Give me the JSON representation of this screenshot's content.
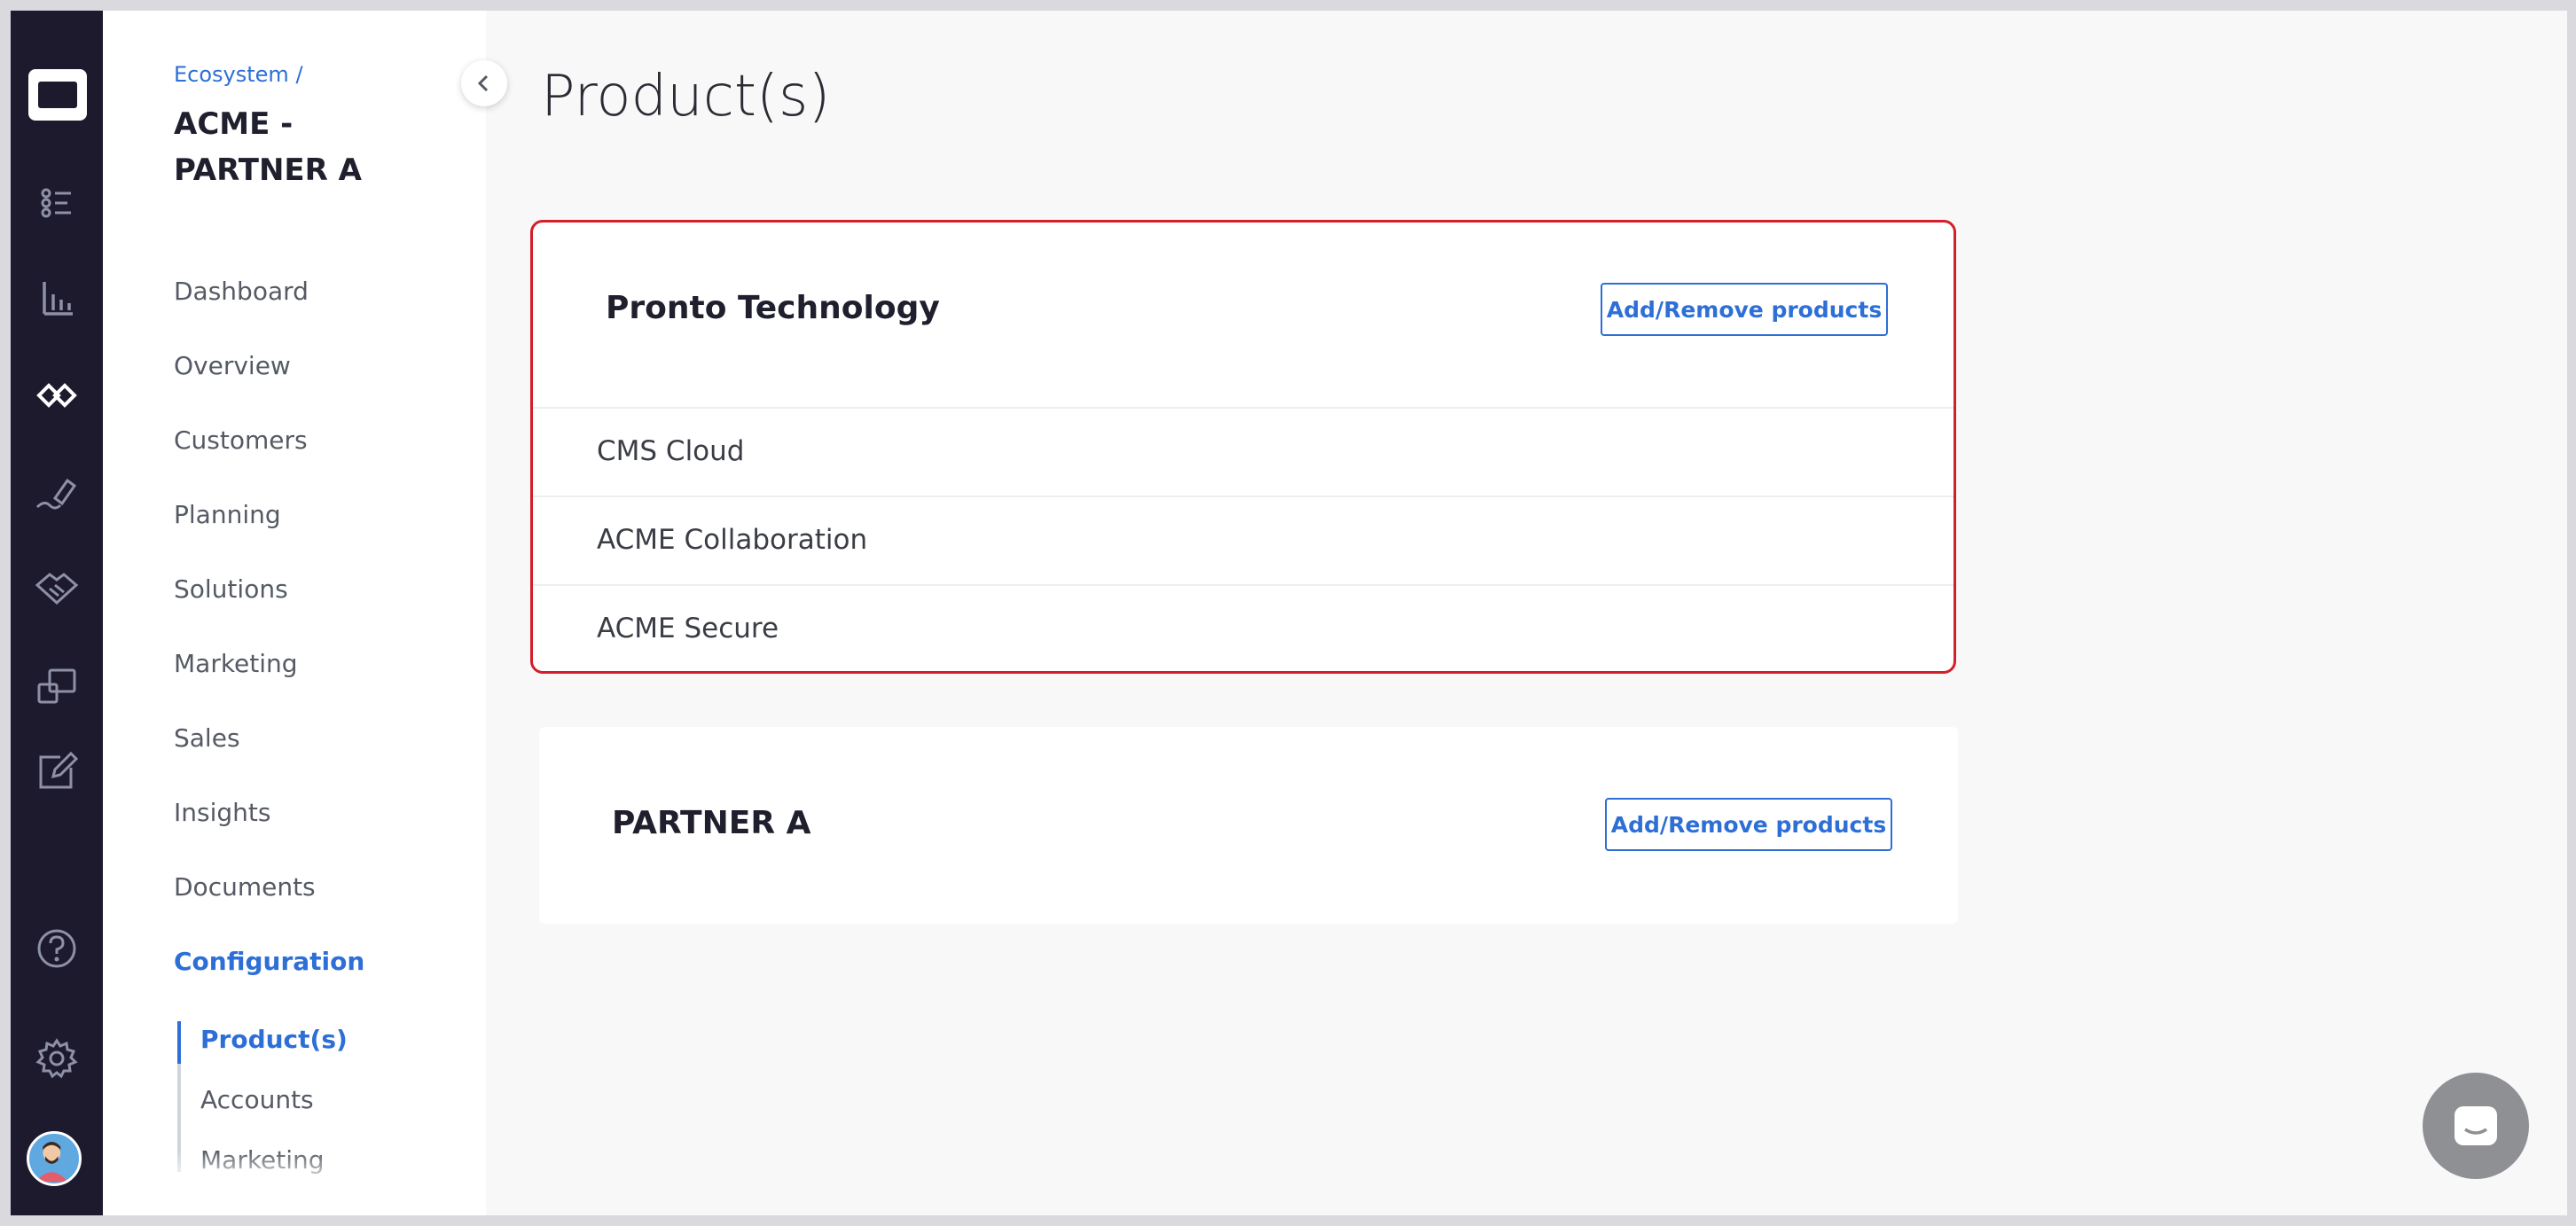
{
  "rail": {
    "icons": [
      "app-logo",
      "checklist-icon",
      "bar-chart-icon",
      "ecosystem-link-icon",
      "signature-pen-icon",
      "handshake-icon",
      "screens-icon",
      "edit-note-icon",
      "help-icon",
      "settings-gear-icon",
      "user-avatar"
    ]
  },
  "sidebar": {
    "breadcrumb": "Ecosystem /",
    "title": "ACME - PARTNER A",
    "items": [
      {
        "label": "Dashboard"
      },
      {
        "label": "Overview"
      },
      {
        "label": "Customers"
      },
      {
        "label": "Planning"
      },
      {
        "label": "Solutions"
      },
      {
        "label": "Marketing"
      },
      {
        "label": "Sales"
      },
      {
        "label": "Insights"
      },
      {
        "label": "Documents"
      },
      {
        "label": "Configuration"
      }
    ],
    "subitems": [
      {
        "label": "Product(s)"
      },
      {
        "label": "Accounts"
      },
      {
        "label": "Marketing"
      }
    ]
  },
  "main": {
    "title": "Product(s)",
    "cards": [
      {
        "name": "Pronto Technology",
        "button": "Add/Remove products",
        "products": [
          "CMS Cloud",
          "ACME Collaboration",
          "ACME Secure"
        ]
      },
      {
        "name": "PARTNER A",
        "button": "Add/Remove products",
        "products": []
      }
    ]
  },
  "colors": {
    "accent": "#2d6fd6",
    "selection_border": "#d21f2a",
    "rail_bg": "#1d1a2e"
  }
}
